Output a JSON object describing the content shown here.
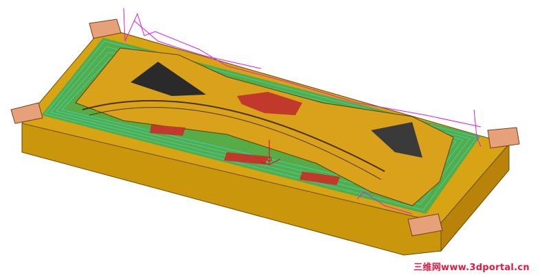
{
  "viewport": {
    "background": "#ffffff",
    "content": "mold-cavity-toolpath-render"
  },
  "colors": {
    "mold_base": "#c9960c",
    "mold_face_light": "#d9a414",
    "mold_face_dark": "#b88308",
    "cavity_surface": "#d9a21a",
    "green_region": "#3fae4e",
    "toolpath_cyan": "#2fd3c0",
    "toolpath_magenta": "#e01adf",
    "red_pockets": "#c0392b",
    "pad_blocks": "#e6a07a",
    "watermark": "#e8173d"
  },
  "icons": {
    "coordinate_marker": "red-axis-triad-icon"
  },
  "watermark": {
    "text": "三维网www.3dportal.cn"
  }
}
